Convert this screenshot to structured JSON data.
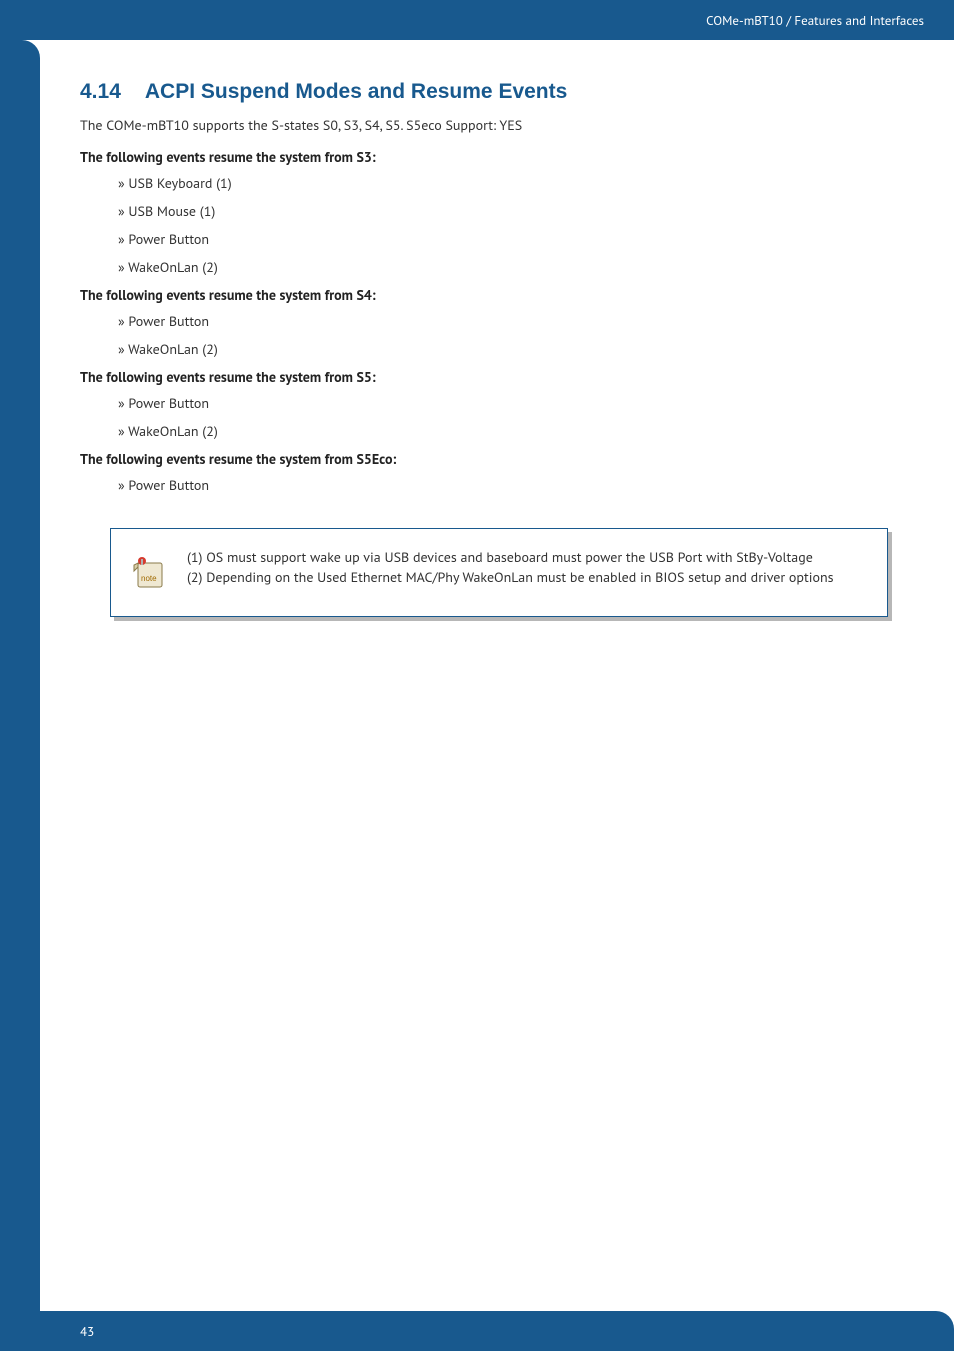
{
  "header": {
    "breadcrumb": "COMe-mBT10 / Features and Interfaces"
  },
  "section": {
    "number": "4.14",
    "title": "ACPI Suspend Modes and Resume Events",
    "intro": "The COMe-mBT10 supports the S-states S0, S3, S4, S5. S5eco Support: YES",
    "groups": [
      {
        "heading": "The following events resume the system from S3:",
        "items": [
          "» USB Keyboard (1)",
          "» USB Mouse (1)",
          "» Power Button",
          "» WakeOnLan (2)"
        ]
      },
      {
        "heading": "The following events resume the system from S4:",
        "items": [
          "» Power Button",
          "» WakeOnLan (2)"
        ]
      },
      {
        "heading": "The following events resume the system from S5:",
        "items": [
          "» Power Button",
          "» WakeOnLan (2)"
        ]
      },
      {
        "heading": "The following events resume the system from S5Eco:",
        "items": [
          "» Power Button"
        ]
      }
    ]
  },
  "note": {
    "line1": "(1) OS must support wake up via USB devices and baseboard must power the USB Port with StBy-Voltage",
    "line2": "(2) Depending on the Used Ethernet MAC/Phy WakeOnLan must be enabled in BIOS setup and driver options"
  },
  "footer": {
    "page_number": "43"
  }
}
